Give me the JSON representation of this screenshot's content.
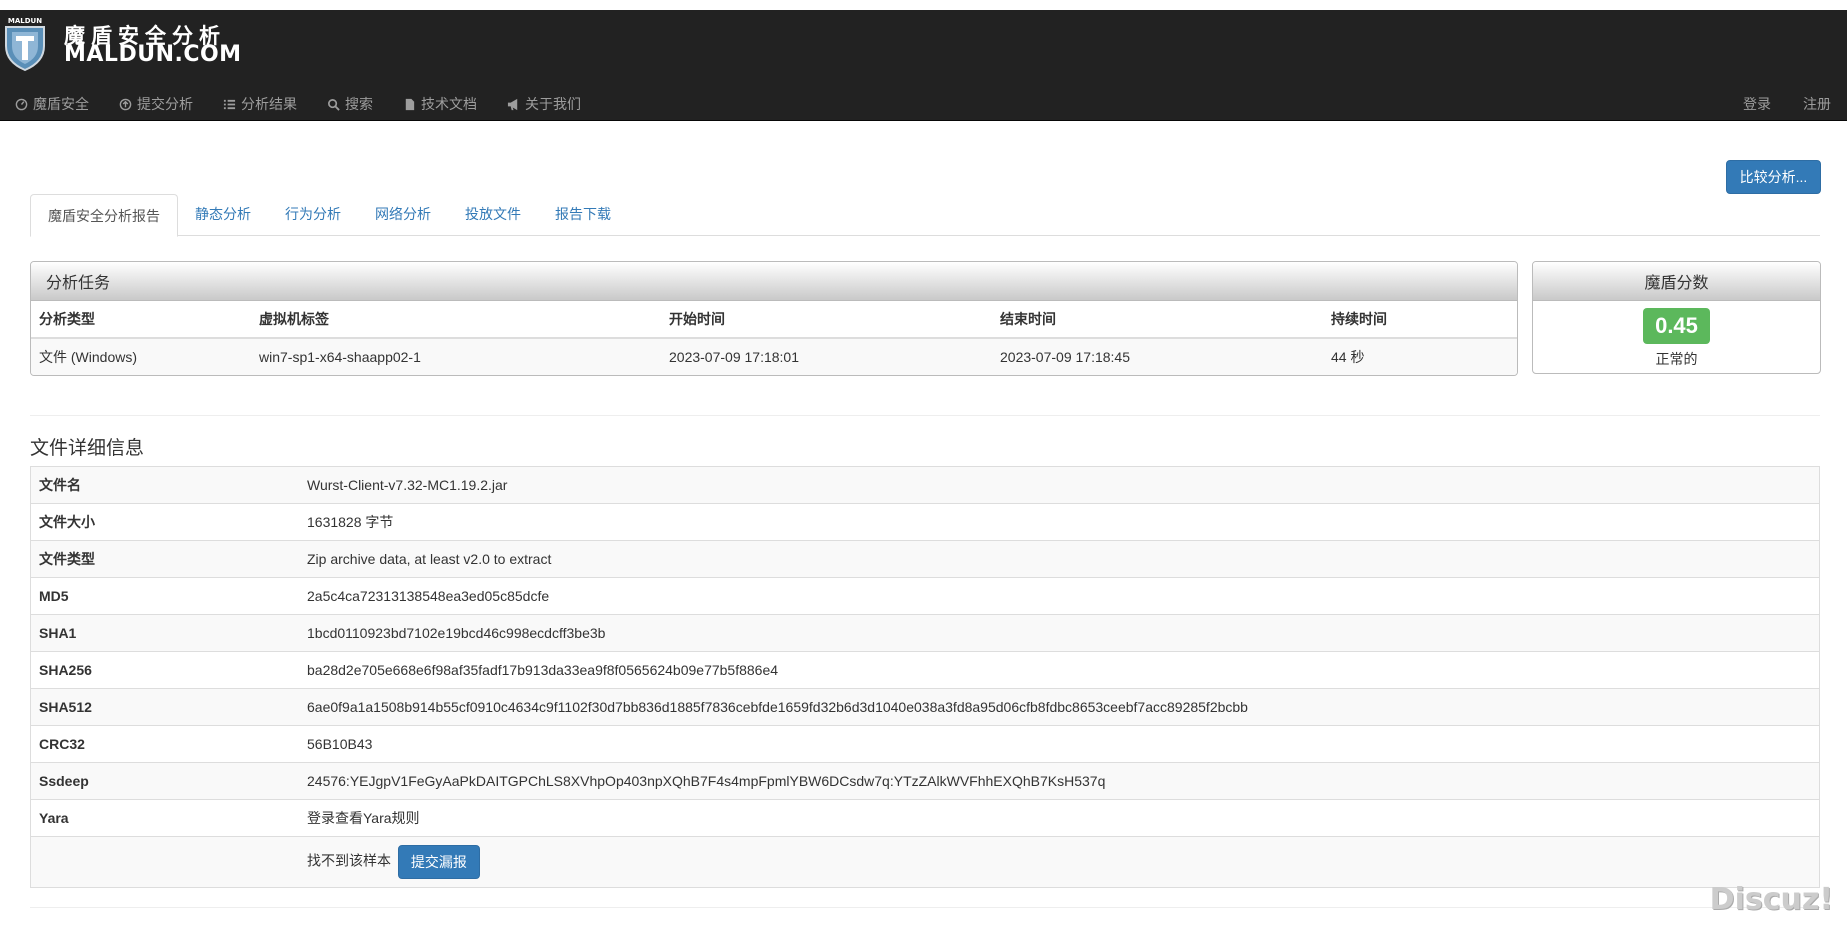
{
  "brand": {
    "logo_text": "MALDUN",
    "name_cn": "魔盾安全分析",
    "name_en": "MALDUN.COM"
  },
  "nav": {
    "items": [
      {
        "label": "魔盾安全",
        "icon": "dashboard-icon"
      },
      {
        "label": "提交分析",
        "icon": "upload-icon"
      },
      {
        "label": "分析结果",
        "icon": "list-icon"
      },
      {
        "label": "搜索",
        "icon": "search-icon"
      },
      {
        "label": "技术文档",
        "icon": "file-icon"
      },
      {
        "label": "关于我们",
        "icon": "bullhorn-icon"
      }
    ],
    "login": "登录",
    "register": "注册"
  },
  "compare_button": "比较分析...",
  "tabs": [
    "魔盾安全分析报告",
    "静态分析",
    "行为分析",
    "网络分析",
    "投放文件",
    "报告下载"
  ],
  "task": {
    "title": "分析任务",
    "headers": [
      "分析类型",
      "虚拟机标签",
      "开始时间",
      "结束时间",
      "持续时间"
    ],
    "row": [
      "文件 (Windows)",
      "win7-sp1-x64-shaapp02-1",
      "2023-07-09 17:18:01",
      "2023-07-09 17:18:45",
      "44 秒"
    ]
  },
  "score": {
    "title": "魔盾分数",
    "value": "0.45",
    "label": "正常的",
    "color": "#5cb85c"
  },
  "file_details": {
    "title": "文件详细信息",
    "rows": [
      {
        "key": "文件名",
        "value": "Wurst-Client-v7.32-MC1.19.2.jar"
      },
      {
        "key": "文件大小",
        "value": "1631828 字节"
      },
      {
        "key": "文件类型",
        "value": "Zip archive data, at least v2.0 to extract"
      },
      {
        "key": "MD5",
        "value": "2a5c4ca72313138548ea3ed05c85dcfe"
      },
      {
        "key": "SHA1",
        "value": "1bcd0110923bd7102e19bcd46c998ecdcff3be3b"
      },
      {
        "key": "SHA256",
        "value": "ba28d2e705e668e6f98af35fadf17b913da33ea9f8f0565624b09e77b5f886e4"
      },
      {
        "key": "SHA512",
        "value": "6ae0f9a1a1508b914b55cf0910c4634c9f1102f30d7bb836d1885f7836cebfde1659fd32b6d3d1040e038a3fd8a95d06cfb8fdbc8653ceebf7acc89285f2bcbb"
      },
      {
        "key": "CRC32",
        "value": "56B10B43"
      },
      {
        "key": "Ssdeep",
        "value": "24576:YEJgpV1FeGyAaPkDAITGPChLS8XVhpOp403npXQhB7F4s4mpFpmlYBW6DCsdw7q:YTzZAlkWVFhhEXQhB7KsH537q"
      },
      {
        "key": "Yara",
        "value": "登录查看Yara规则"
      }
    ],
    "missing_text": "找不到该样本",
    "report_button": "提交漏报"
  },
  "watermark": "Discuz!"
}
